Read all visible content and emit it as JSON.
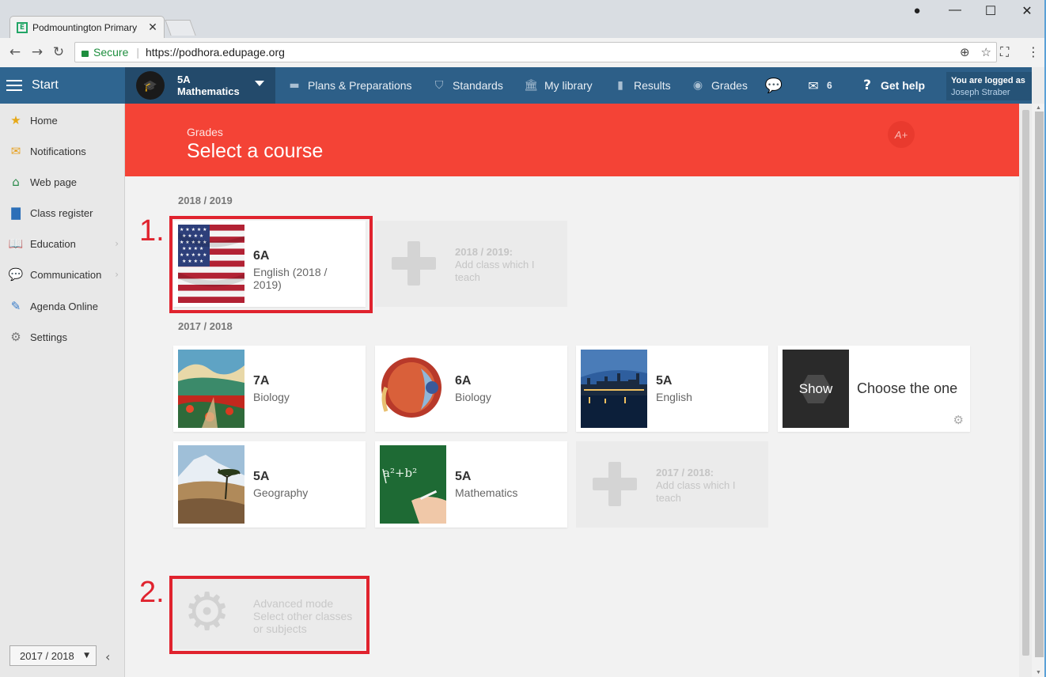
{
  "browser": {
    "tab_title": "Podmountington Primary",
    "tab_favicon": "E",
    "secure_label": "Secure",
    "url": "https://podhora.edupage.org",
    "icons": [
      "back-icon",
      "forward-icon",
      "reload-icon",
      "zoom-icon",
      "star-icon",
      "cast-icon",
      "menu-icon",
      "profile-icon"
    ]
  },
  "appbar": {
    "start_label": "Start",
    "class_code": "5A",
    "class_subject": "Mathematics",
    "menu": [
      {
        "label": "Plans & Preparations",
        "icon": "briefcase-icon"
      },
      {
        "label": "Standards",
        "icon": "shield-check-icon"
      },
      {
        "label": "My library",
        "icon": "library-icon"
      },
      {
        "label": "Results",
        "icon": "bar-chart-icon"
      },
      {
        "label": "Grades",
        "icon": "grades-icon"
      }
    ],
    "messages_count": "6",
    "help_label": "Get help",
    "logged_label": "You are logged as",
    "user_name": "Joseph Straber"
  },
  "sidebar": {
    "items": [
      {
        "label": "Home",
        "icon": "star-icon",
        "color": "#e6a817"
      },
      {
        "label": "Notifications",
        "icon": "envelope-icon",
        "color": "#e6a020"
      },
      {
        "label": "Web page",
        "icon": "house-icon",
        "color": "#2a8a4a"
      },
      {
        "label": "Class register",
        "icon": "book-icon",
        "color": "#2c6fb8"
      },
      {
        "label": "Education",
        "icon": "open-book-icon",
        "color": "#2c6fb8"
      },
      {
        "label": "Communication",
        "icon": "chat-icon",
        "color": "#d23c2c"
      },
      {
        "label": "Agenda Online",
        "icon": "pen-icon",
        "color": "#3a7dc9"
      },
      {
        "label": "Settings",
        "icon": "gear-icon",
        "color": "#777777"
      }
    ],
    "year_select": "2017 / 2018"
  },
  "banner": {
    "small": "Grades",
    "title": "Select a course",
    "badge": "A+",
    "color": "#f44336"
  },
  "years": [
    {
      "label": "2018 / 2019",
      "courses": [
        {
          "class": "6A",
          "subject": "English (2018 / 2019)",
          "image": "us-flag"
        }
      ],
      "add": {
        "year": "2018 / 2019:",
        "text": "Add class which I teach"
      }
    },
    {
      "label": "2017 / 2018",
      "courses": [
        {
          "class": "7A",
          "subject": "Biology",
          "image": "painting"
        },
        {
          "class": "6A",
          "subject": "Biology",
          "image": "eye"
        },
        {
          "class": "5A",
          "subject": "English",
          "image": "london"
        },
        {
          "class": "5A",
          "subject": "Geography",
          "image": "savanna"
        },
        {
          "class": "5A",
          "subject": "Mathematics",
          "image": "chalkboard"
        }
      ],
      "show": {
        "badge": "Show",
        "text": "Choose the one"
      },
      "add": {
        "year": "2017 / 2018:",
        "text": "Add class which I teach"
      }
    }
  ],
  "advanced": {
    "line1": "Advanced mode",
    "line2": "Select other classes or subjects"
  },
  "annotations": {
    "step1": "1.",
    "step2": "2.",
    "color": "#e0232e"
  }
}
